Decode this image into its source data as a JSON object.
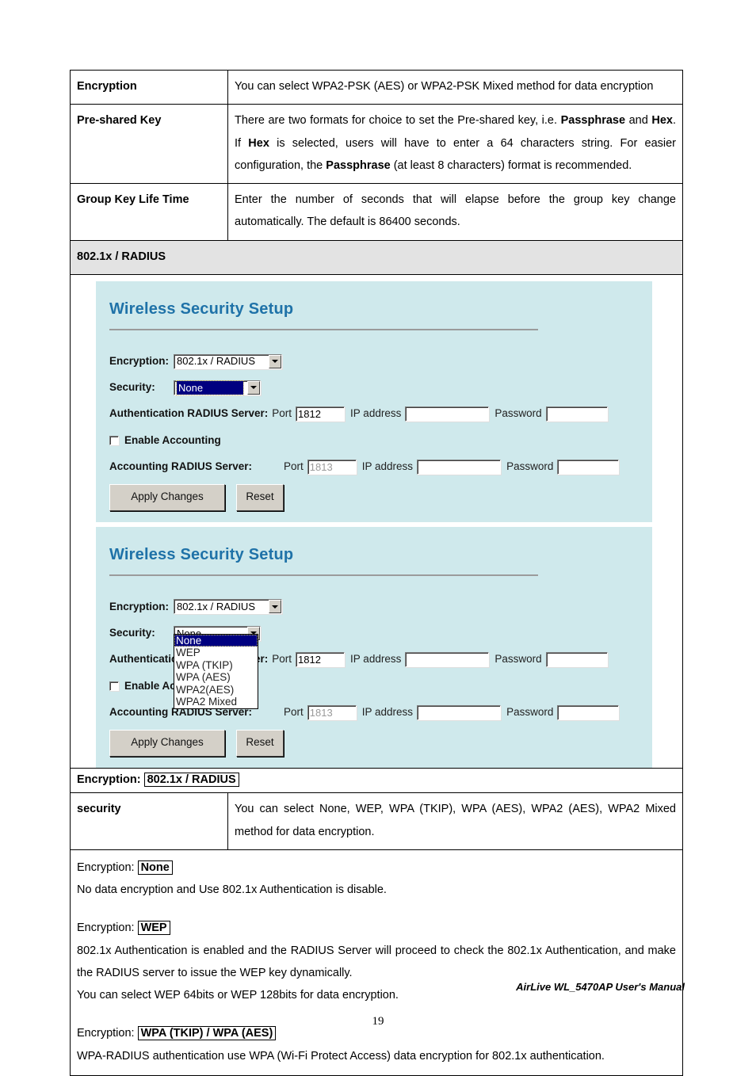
{
  "doc": {
    "rows": [
      {
        "label": "Encryption",
        "desc_html": "You can select WPA2-PSK (AES) or WPA2-PSK Mixed method for data encryption"
      },
      {
        "label": "Pre-shared Key",
        "desc_html": "There are two formats for choice to set the Pre-shared key, i.e. <b>Passphrase</b> and <b>Hex</b>. If <b>Hex</b> is selected, users will have to enter a 64 characters string. For easier configuration, the <b>Passphrase</b> (at least 8 characters) format is recommended."
      },
      {
        "label": "Group Key Life Time",
        "desc_html": "Enter the number of seconds that will elapse before the group key change automatically. The default is 86400 seconds."
      }
    ],
    "section_bar": "802.1x / RADIUS",
    "encryption_caption_prefix": "Encryption:",
    "encryption_caption_value": "802.1x / RADIUS",
    "security_row": {
      "label": "security",
      "desc": "You can select None, WEP, WPA (TKIP), WPA (AES), WPA2 (AES), WPA2 Mixed method for data encryption."
    },
    "prose": {
      "none_prefix": "Encryption:",
      "none_value": "None",
      "none_body": "No data encryption and Use 802.1x Authentication is disable.",
      "wep_prefix": "Encryption:",
      "wep_value": "WEP",
      "wep_body1": "802.1x Authentication is enabled and the RADIUS Server will proceed to check the 802.1x Authentication, and make the RADIUS server to issue the WEP key dynamically.",
      "wep_body2": "You can select WEP 64bits or WEP 128bits for data encryption.",
      "wpa_prefix": "Encryption:",
      "wpa_value": "WPA (TKIP) / WPA (AES)",
      "wpa_body": "WPA-RADIUS authentication use WPA (Wi-Fi Protect Access) data encryption for 802.1x authentication."
    }
  },
  "ui": {
    "title": "Wireless Security Setup",
    "encryption_label": "Encryption:",
    "encryption_value": "802.1x / RADIUS",
    "security_label": "Security:",
    "security_value": "None",
    "security_options": [
      "None",
      "WEP",
      "WPA (TKIP)",
      "WPA (AES)",
      "WPA2(AES)",
      "WPA2 Mixed"
    ],
    "auth_server_label": "Authentication RADIUS Server:",
    "acct_server_label": "Accounting RADIUS Server:",
    "port_label": "Port",
    "ip_label": "IP address",
    "password_label": "Password",
    "auth_port_value": "1812",
    "acct_port_value": "1813",
    "auth_ip_value": "",
    "auth_pw_value": "",
    "acct_ip_value": "",
    "acct_pw_value": "",
    "enable_accounting_label": "Enable Accounting",
    "apply_label": "Apply Changes",
    "reset_label": "Reset",
    "colors": {
      "panel_bg": "#cfe9ec",
      "title": "#1f72a8",
      "highlight": "#000080",
      "button_face": "#d4d0c8",
      "section_bar": "#e3e3e3"
    }
  },
  "footer": {
    "page_number": "19",
    "manual_note": "AirLive WL_5470AP User's Manual"
  }
}
